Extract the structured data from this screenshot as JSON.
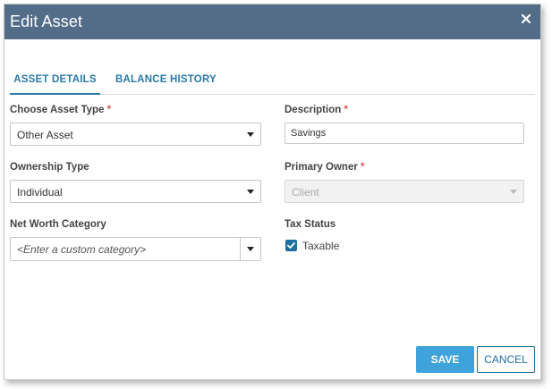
{
  "dialog": {
    "title": "Edit Asset",
    "close_icon": "close-icon"
  },
  "tabs": [
    {
      "label": "ASSET DETAILS",
      "active": true
    },
    {
      "label": "BALANCE HISTORY",
      "active": false
    }
  ],
  "fields": {
    "asset_type": {
      "label": "Choose Asset Type",
      "required": "*",
      "value": "Other Asset"
    },
    "description": {
      "label": "Description",
      "required": "*",
      "value": "Savings"
    },
    "ownership_type": {
      "label": "Ownership Type",
      "value": "Individual"
    },
    "primary_owner": {
      "label": "Primary Owner",
      "required": "*",
      "value": "Client",
      "disabled": true
    },
    "net_worth_category": {
      "label": "Net Worth Category",
      "placeholder": "<Enter a custom category>"
    },
    "tax_status": {
      "label": "Tax Status",
      "checkbox_label": "Taxable",
      "checked": true
    }
  },
  "buttons": {
    "save": "SAVE",
    "cancel": "CANCEL"
  },
  "colors": {
    "titlebar": "#536d89",
    "accent": "#2b79a8",
    "save_button": "#3ea2db",
    "required": "#d9534f"
  }
}
